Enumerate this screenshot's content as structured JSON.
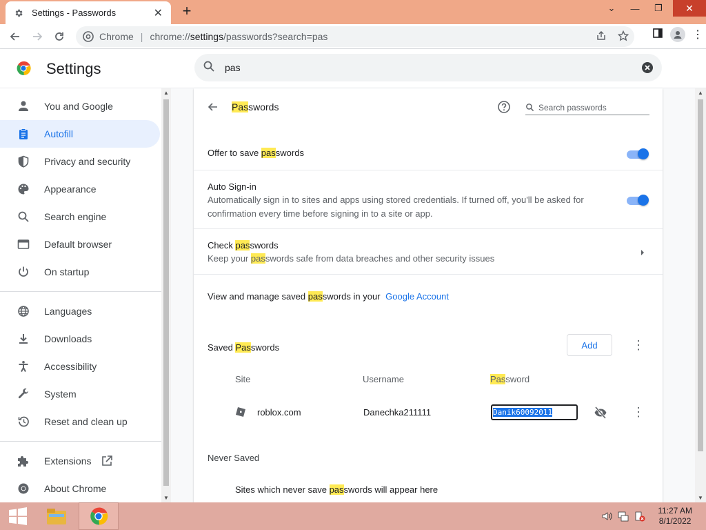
{
  "browser": {
    "tab_title": "Settings - Passwords",
    "omnibox_site": "Chrome",
    "url_scheme": "chrome://",
    "url_host": "settings",
    "url_path": "/passwords?search=pas"
  },
  "header": {
    "title": "Settings",
    "search_value": "pas"
  },
  "sidebar": {
    "items": [
      {
        "label": "You and Google"
      },
      {
        "label": "Autofill"
      },
      {
        "label": "Privacy and security"
      },
      {
        "label": "Appearance"
      },
      {
        "label": "Search engine"
      },
      {
        "label": "Default browser"
      },
      {
        "label": "On startup"
      },
      {
        "label": "Languages"
      },
      {
        "label": "Downloads"
      },
      {
        "label": "Accessibility"
      },
      {
        "label": "System"
      },
      {
        "label": "Reset and clean up"
      },
      {
        "label": "Extensions"
      },
      {
        "label": "About Chrome"
      }
    ]
  },
  "page": {
    "title_hl": "Pas",
    "title_rest": "swords",
    "search_placeholder": "Search passwords",
    "offer": {
      "pre": "Offer to save ",
      "hl": "pas",
      "post": "swords",
      "enabled": true
    },
    "autosignin": {
      "title": "Auto Sign-in",
      "desc1": "Automatically sign in to sites and apps using stored credentials. If turned off, you'll be asked for",
      "desc2": "confirmation every time before signing in to a site or app.",
      "enabled": true
    },
    "check": {
      "title_pre": "Check ",
      "title_hl": "pas",
      "title_post": "swords",
      "desc_pre": "Keep your ",
      "desc_hl": "pas",
      "desc_post": "swords safe from data breaches and other security issues"
    },
    "manage": {
      "pre": "View and manage saved ",
      "hl": "pas",
      "post": "swords in your",
      "link": "Google Account"
    },
    "saved": {
      "title_pre": "Saved ",
      "title_hl": "Pas",
      "title_post": "swords",
      "add_label": "Add",
      "col_site": "Site",
      "col_username": "Username",
      "col_password_hl": "Pas",
      "col_password_rest": "sword",
      "entries": [
        {
          "site": "roblox.com",
          "username": "Danechka211111",
          "password": "Danik60092011"
        }
      ]
    },
    "never": {
      "title": "Never Saved",
      "desc_pre": "Sites which never save ",
      "desc_hl": "pas",
      "desc_post": "swords will appear here"
    }
  },
  "taskbar": {
    "time": "11:27 AM",
    "date": "8/1/2022"
  },
  "colors": {
    "accent": "#1a73e8",
    "highlight": "#ffea54",
    "titlebar": "#f0a888",
    "taskbar": "#e0aaa0"
  }
}
